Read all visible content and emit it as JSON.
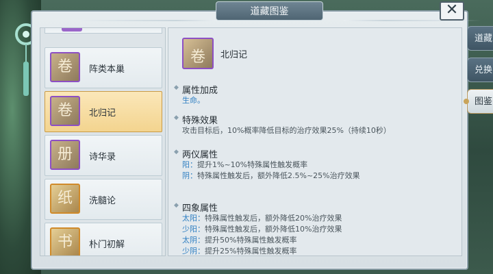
{
  "window": {
    "title": "道藏图鉴",
    "close_label": "✕"
  },
  "tabs": [
    {
      "label": "道藏",
      "active": false
    },
    {
      "label": "兑换",
      "active": false
    },
    {
      "label": "图鉴",
      "active": true
    }
  ],
  "list": {
    "items": [
      {
        "label": "阵类本巢",
        "icon": "scroll-seal-icon",
        "selected": false,
        "rarity": "purple"
      },
      {
        "label": "北归记",
        "icon": "scroll-icon",
        "selected": true,
        "rarity": "purple"
      },
      {
        "label": "诗华录",
        "icon": "open-book-icon",
        "selected": false,
        "rarity": "purple"
      },
      {
        "label": "洗髓论",
        "icon": "parchment-icon",
        "selected": false,
        "rarity": "orange"
      },
      {
        "label": "朴门初解",
        "icon": "book-icon",
        "selected": false,
        "rarity": "orange"
      }
    ]
  },
  "detail": {
    "name": "北归记",
    "icon": "scroll-icon",
    "attr_bonus": {
      "heading": "属性加成",
      "value": "生命。"
    },
    "special": {
      "heading": "特殊效果",
      "text": "攻击目标后，10%概率降低目标的治疗效果25%（持续10秒）"
    },
    "liangyi": {
      "heading": "两仪属性",
      "lines": [
        {
          "key": "阳：",
          "text": "提升1%~10%特殊属性触发概率"
        },
        {
          "key": "阴：",
          "text": "特殊属性触发后，额外降低2.5%~25%治疗效果"
        }
      ]
    },
    "sixiang": {
      "heading": "四象属性",
      "lines": [
        {
          "key": "太阳：",
          "text": "特殊属性触发后，额外降低20%治疗效果"
        },
        {
          "key": "少阳：",
          "text": "特殊属性触发后，额外降低10%治疗效果"
        },
        {
          "key": "太阴：",
          "text": "提升50%特殊属性触发概率"
        },
        {
          "key": "少阴：",
          "text": "提升25%特殊属性触发概率"
        }
      ]
    }
  },
  "colors": {
    "accent_blue": "#2f7fc2",
    "selected_gold": "#f3d48f",
    "rarity_purple": "#8d4fc4",
    "rarity_orange": "#d08a2a"
  }
}
